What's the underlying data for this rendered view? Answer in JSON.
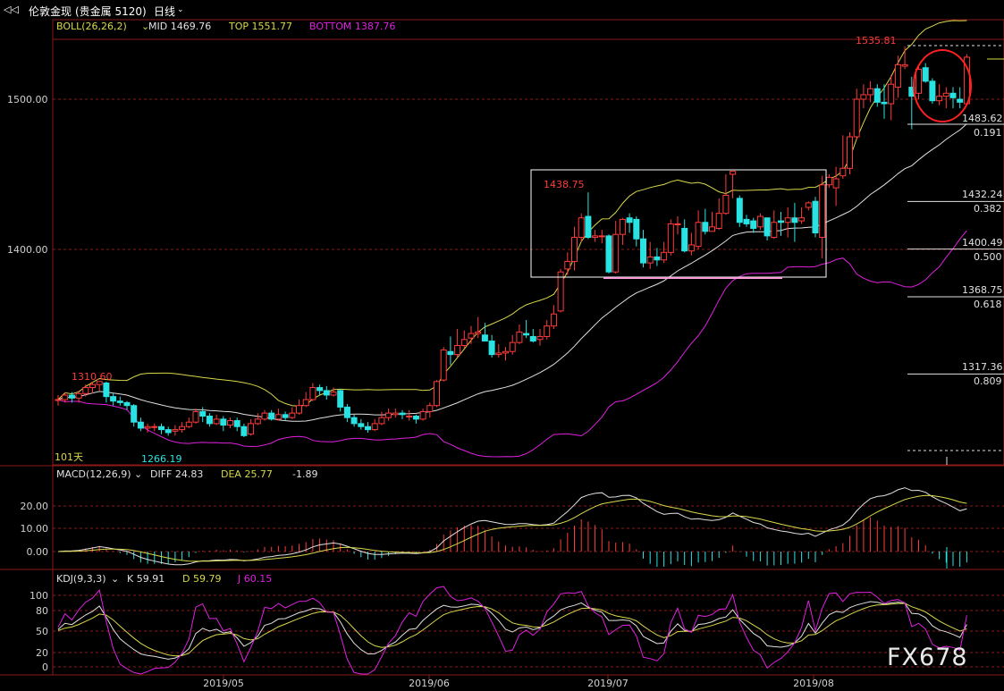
{
  "window": {
    "title": "伦敦金现",
    "market": "(贵金属 5120)",
    "period": "日线",
    "watermark": "FX678"
  },
  "indicators": {
    "boll": {
      "name": "BOLL(26,26,2)",
      "mid": "MID 1469.76",
      "top": "TOP 1551.77",
      "bottom": "BOTTOM 1387.76"
    },
    "macd": {
      "name": "MACD(12,26,9)",
      "diff": "DIFF 24.83",
      "dea": "DEA 25.77",
      "macd": "-1.89"
    },
    "kdj": {
      "name": "KDJ(9,3,3)",
      "k": "K 59.91",
      "d": "D 59.79",
      "j": "J 60.15"
    }
  },
  "price_annotations": {
    "high_label": "1535.81",
    "mid_high": "1438.75",
    "left_high": "1310.60",
    "low": "1266.19",
    "bars_count": "101天"
  },
  "fibonacci": [
    {
      "price": "1483.62",
      "ratio": "0.191"
    },
    {
      "price": "1432.24",
      "ratio": "0.382"
    },
    {
      "price": "1400.49",
      "ratio": "0.500"
    },
    {
      "price": "1368.75",
      "ratio": "0.618"
    },
    {
      "price": "1317.36",
      "ratio": "0.809"
    }
  ],
  "colors": {
    "up": "#ff3b3b",
    "down": "#29e3e3",
    "mid_line": "#e0e0e0",
    "top_line": "#d8d84a",
    "bottom_line": "#e020e0",
    "grid": "#8b1a1a"
  },
  "chart_data": {
    "type": "candlestick",
    "title": "伦敦金现 日线",
    "x_ticks": [
      "2019/05",
      "2019/06",
      "2019/07",
      "2019/08"
    ],
    "price_axis": {
      "ticks": [
        "1500.00",
        "1400.00"
      ],
      "range": [
        1237,
        1578
      ]
    },
    "macd_axis": {
      "ticks": [
        "20.00",
        "10.00",
        "0.00"
      ]
    },
    "kdj_axis": {
      "ticks": [
        "100",
        "80",
        "50",
        "20",
        "0"
      ]
    },
    "candles": [
      [
        1300,
        1300,
        1296,
        1303
      ],
      [
        1300,
        1303,
        1298,
        1305
      ],
      [
        1303,
        1301,
        1298,
        1305
      ],
      [
        1301,
        1304,
        1298,
        1306
      ],
      [
        1304,
        1308,
        1302,
        1310
      ],
      [
        1308,
        1310,
        1304,
        1312
      ],
      [
        1310,
        1312,
        1306,
        1312
      ],
      [
        1311,
        1302,
        1298,
        1312
      ],
      [
        1302,
        1299,
        1296,
        1304
      ],
      [
        1299,
        1298,
        1296,
        1302
      ],
      [
        1298,
        1296,
        1293,
        1299
      ],
      [
        1296,
        1285,
        1282,
        1297
      ],
      [
        1285,
        1281,
        1279,
        1288
      ],
      [
        1281,
        1282,
        1278,
        1284
      ],
      [
        1282,
        1282,
        1279,
        1284
      ],
      [
        1282,
        1280,
        1277,
        1284
      ],
      [
        1280,
        1278,
        1276,
        1282
      ],
      [
        1279,
        1280,
        1276,
        1283
      ],
      [
        1280,
        1282,
        1278,
        1285
      ],
      [
        1282,
        1285,
        1281,
        1288
      ],
      [
        1285,
        1292,
        1284,
        1294
      ],
      [
        1292,
        1289,
        1285,
        1295
      ],
      [
        1289,
        1284,
        1282,
        1291
      ],
      [
        1284,
        1287,
        1283,
        1290
      ],
      [
        1287,
        1283,
        1279,
        1289
      ],
      [
        1283,
        1286,
        1281,
        1288
      ],
      [
        1286,
        1282,
        1279,
        1288
      ],
      [
        1282,
        1276,
        1275,
        1284
      ],
      [
        1277,
        1284,
        1276,
        1287
      ],
      [
        1284,
        1287,
        1283,
        1291
      ],
      [
        1287,
        1291,
        1286,
        1293
      ],
      [
        1291,
        1287,
        1286,
        1293
      ],
      [
        1287,
        1290,
        1286,
        1294
      ],
      [
        1290,
        1288,
        1286,
        1292
      ],
      [
        1288,
        1291,
        1287,
        1295
      ],
      [
        1291,
        1296,
        1290,
        1300
      ],
      [
        1296,
        1300,
        1295,
        1305
      ],
      [
        1300,
        1308,
        1299,
        1311
      ],
      [
        1308,
        1306,
        1303,
        1310
      ],
      [
        1306,
        1303,
        1300,
        1309
      ],
      [
        1303,
        1305,
        1302,
        1308
      ],
      [
        1306,
        1295,
        1292,
        1307
      ],
      [
        1295,
        1288,
        1285,
        1297
      ],
      [
        1288,
        1284,
        1282,
        1290
      ],
      [
        1284,
        1282,
        1280,
        1287
      ],
      [
        1282,
        1280,
        1278,
        1285
      ],
      [
        1280,
        1284,
        1279,
        1287
      ],
      [
        1284,
        1288,
        1283,
        1292
      ],
      [
        1288,
        1291,
        1286,
        1294
      ],
      [
        1290,
        1291,
        1288,
        1294
      ],
      [
        1291,
        1290,
        1287,
        1293
      ],
      [
        1289,
        1289,
        1286,
        1293
      ],
      [
        1289,
        1287,
        1284,
        1290
      ],
      [
        1287,
        1292,
        1286,
        1294
      ],
      [
        1292,
        1296,
        1288,
        1298
      ],
      [
        1296,
        1312,
        1295,
        1313
      ],
      [
        1313,
        1333,
        1312,
        1335
      ],
      [
        1332,
        1330,
        1323,
        1342
      ],
      [
        1330,
        1336,
        1328,
        1347
      ],
      [
        1336,
        1340,
        1334,
        1346
      ],
      [
        1341,
        1344,
        1337,
        1349
      ],
      [
        1344,
        1345,
        1341,
        1355
      ],
      [
        1343,
        1339,
        1339,
        1351
      ],
      [
        1339,
        1330,
        1328,
        1343
      ],
      [
        1330,
        1331,
        1328,
        1337
      ],
      [
        1331,
        1332,
        1326,
        1335
      ],
      [
        1332,
        1338,
        1330,
        1343
      ],
      [
        1338,
        1345,
        1337,
        1350
      ],
      [
        1344,
        1343,
        1341,
        1353
      ],
      [
        1342,
        1339,
        1338,
        1347
      ],
      [
        1340,
        1342,
        1336,
        1347
      ],
      [
        1342,
        1349,
        1340,
        1353
      ],
      [
        1349,
        1357,
        1347,
        1363
      ],
      [
        1359,
        1385,
        1358,
        1387
      ],
      [
        1387,
        1392,
        1383,
        1398
      ],
      [
        1392,
        1408,
        1386,
        1415
      ],
      [
        1408,
        1421,
        1405,
        1424
      ],
      [
        1422,
        1408,
        1407,
        1438
      ],
      [
        1408,
        1409,
        1405,
        1413
      ],
      [
        1409,
        1409,
        1404,
        1413
      ],
      [
        1409,
        1385,
        1384,
        1410
      ],
      [
        1385,
        1410,
        1384,
        1419
      ],
      [
        1410,
        1420,
        1403,
        1421
      ],
      [
        1421,
        1418,
        1411,
        1424
      ],
      [
        1420,
        1407,
        1402,
        1422
      ],
      [
        1407,
        1391,
        1388,
        1413
      ],
      [
        1391,
        1395,
        1387,
        1405
      ],
      [
        1395,
        1393,
        1389,
        1401
      ],
      [
        1393,
        1398,
        1391,
        1405
      ],
      [
        1398,
        1417,
        1396,
        1420
      ],
      [
        1417,
        1417,
        1410,
        1422
      ],
      [
        1414,
        1399,
        1398,
        1420
      ],
      [
        1399,
        1403,
        1396,
        1411
      ],
      [
        1402,
        1418,
        1400,
        1426
      ],
      [
        1418,
        1412,
        1410,
        1427
      ],
      [
        1412,
        1415,
        1412,
        1425
      ],
      [
        1414,
        1424,
        1413,
        1434
      ],
      [
        1424,
        1436,
        1423,
        1450
      ],
      [
        1450,
        1452,
        1434,
        1452
      ],
      [
        1434,
        1418,
        1415,
        1436
      ],
      [
        1420,
        1417,
        1415,
        1423
      ],
      [
        1419,
        1414,
        1411,
        1421
      ],
      [
        1415,
        1422,
        1413,
        1424
      ],
      [
        1421,
        1409,
        1406,
        1421
      ],
      [
        1408,
        1418,
        1407,
        1426
      ],
      [
        1419,
        1418,
        1409,
        1425
      ],
      [
        1418,
        1421,
        1408,
        1428
      ],
      [
        1421,
        1418,
        1405,
        1431
      ],
      [
        1419,
        1421,
        1417,
        1428
      ],
      [
        1428,
        1431,
        1426,
        1432
      ],
      [
        1432,
        1411,
        1408,
        1435
      ],
      [
        1408,
        1443,
        1394,
        1449
      ],
      [
        1443,
        1448,
        1441,
        1450
      ],
      [
        1441,
        1447,
        1429,
        1455
      ],
      [
        1449,
        1454,
        1447,
        1476
      ],
      [
        1454,
        1475,
        1450,
        1478
      ],
      [
        1475,
        1500,
        1473,
        1507
      ],
      [
        1500,
        1503,
        1494,
        1510
      ],
      [
        1503,
        1507,
        1498,
        1512
      ],
      [
        1507,
        1498,
        1495,
        1510
      ],
      [
        1498,
        1497,
        1487,
        1510
      ],
      [
        1497,
        1510,
        1486,
        1516
      ],
      [
        1508,
        1523,
        1501,
        1529
      ],
      [
        1522,
        1523,
        1520,
        1535
      ],
      [
        1508,
        1502,
        1480,
        1515
      ],
      [
        1504,
        1520,
        1500,
        1523
      ],
      [
        1521,
        1512,
        1511,
        1524
      ],
      [
        1512,
        1499,
        1497,
        1514
      ],
      [
        1499,
        1502,
        1496,
        1510
      ],
      [
        1502,
        1504,
        1494,
        1508
      ],
      [
        1504,
        1501,
        1494,
        1508
      ],
      [
        1500,
        1498,
        1494,
        1508
      ],
      [
        1497,
        1528,
        1496,
        1530
      ]
    ]
  }
}
